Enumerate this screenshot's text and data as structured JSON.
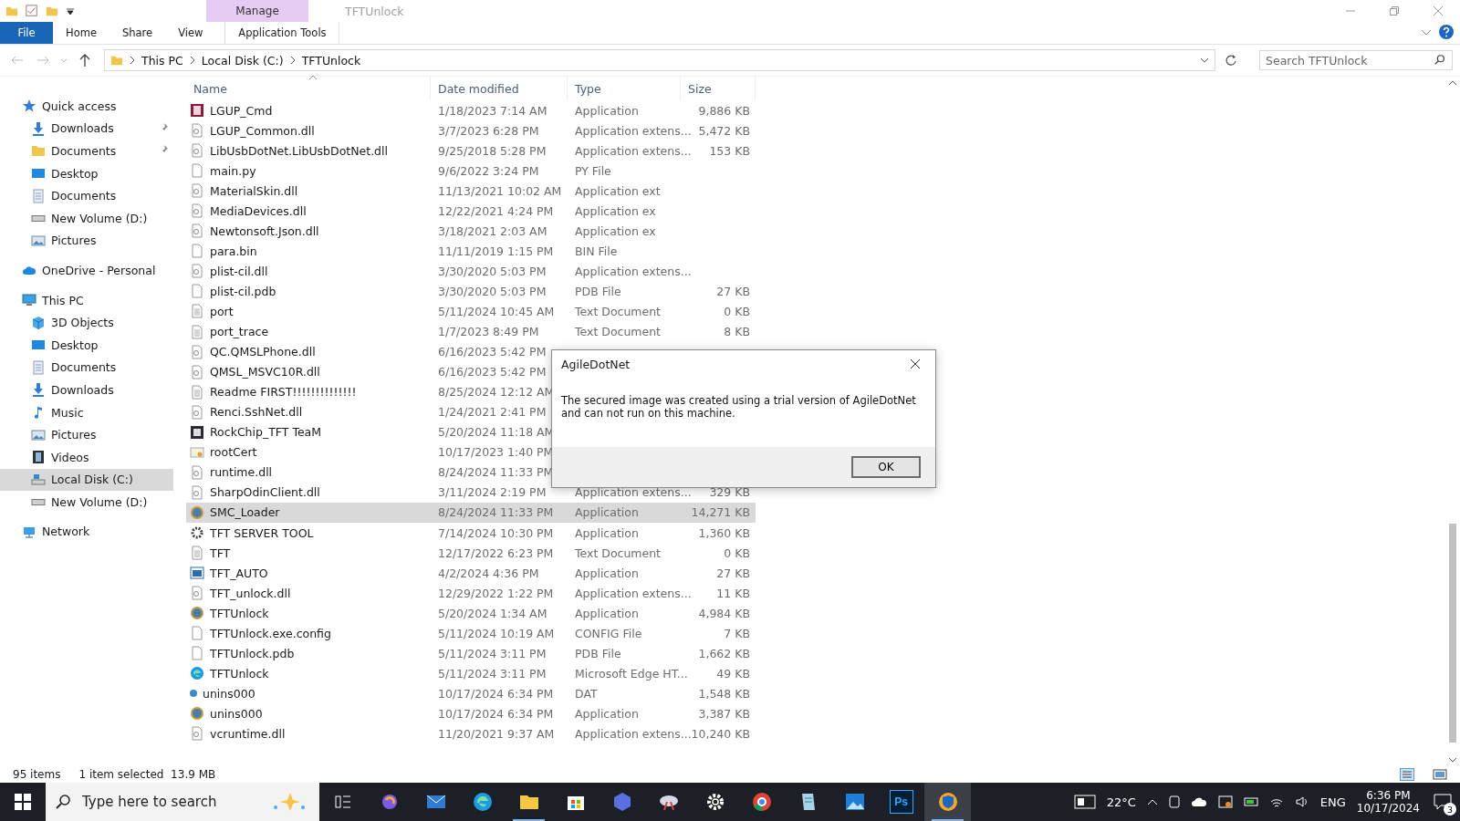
{
  "window": {
    "title": "TFTUnlock",
    "context_tab": "Manage"
  },
  "ribbon_tabs": [
    {
      "label": "File",
      "kind": "file"
    },
    {
      "label": "Home",
      "kind": "plain"
    },
    {
      "label": "Share",
      "kind": "plain"
    },
    {
      "label": "View",
      "kind": "plain"
    },
    {
      "label": "Application Tools",
      "kind": "contextual"
    }
  ],
  "address": {
    "path": [
      "This PC",
      "Local Disk (C:)",
      "TFTUnlock"
    ]
  },
  "search": {
    "placeholder": "Search TFTUnlock"
  },
  "sidebar": {
    "items": [
      {
        "label": "Quick access",
        "kind": "star",
        "selected": false,
        "children": [
          {
            "label": "Downloads",
            "kind": "download",
            "pinned": true,
            "selected": false
          },
          {
            "label": "Documents",
            "kind": "folder",
            "pinned": true,
            "selected": false
          },
          {
            "label": "Desktop",
            "kind": "desktop",
            "pinned": false,
            "selected": false
          },
          {
            "label": "Documents",
            "kind": "document",
            "pinned": false,
            "selected": false
          },
          {
            "label": "New Volume (D:)",
            "kind": "drive",
            "pinned": false,
            "selected": false
          },
          {
            "label": "Pictures",
            "kind": "pictures",
            "pinned": false,
            "selected": false
          }
        ]
      },
      {
        "label": "OneDrive - Personal",
        "kind": "cloud",
        "selected": false
      },
      {
        "label": "This PC",
        "kind": "pc",
        "selected": false,
        "children": [
          {
            "label": "3D Objects",
            "kind": "cube",
            "selected": false
          },
          {
            "label": "Desktop",
            "kind": "desktop",
            "selected": false
          },
          {
            "label": "Documents",
            "kind": "document",
            "selected": false
          },
          {
            "label": "Downloads",
            "kind": "download",
            "selected": false
          },
          {
            "label": "Music",
            "kind": "music",
            "selected": false
          },
          {
            "label": "Pictures",
            "kind": "pictures",
            "selected": false
          },
          {
            "label": "Videos",
            "kind": "video",
            "selected": false
          },
          {
            "label": "Local Disk (C:)",
            "kind": "windrive",
            "selected": true
          },
          {
            "label": "New Volume (D:)",
            "kind": "drive",
            "selected": false
          }
        ]
      },
      {
        "label": "Network",
        "kind": "network",
        "selected": false
      }
    ]
  },
  "table": {
    "columns": [
      {
        "label": "Name",
        "sorted": true
      },
      {
        "label": "Date modified",
        "sorted": false
      },
      {
        "label": "Type",
        "sorted": false
      },
      {
        "label": "Size",
        "sorted": false
      }
    ],
    "rows": [
      {
        "name": "LGUP_Cmd",
        "date": "1/18/2023 7:14 AM",
        "type": "Application",
        "size": "9,886 KB",
        "kind": "exe-red",
        "selected": false
      },
      {
        "name": "LGUP_Common.dll",
        "date": "3/7/2023 6:28 PM",
        "type": "Application extens...",
        "size": "5,472 KB",
        "kind": "dll",
        "selected": false
      },
      {
        "name": "LibUsbDotNet.LibUsbDotNet.dll",
        "date": "9/25/2018 5:28 PM",
        "type": "Application extens...",
        "size": "153 KB",
        "kind": "dll",
        "selected": false
      },
      {
        "name": "main.py",
        "date": "9/6/2022 3:24 PM",
        "type": "PY File",
        "kind": "blank",
        "selected": false
      },
      {
        "name": "MaterialSkin.dll",
        "date": "11/13/2021 10:02 AM",
        "type": "Application ext",
        "kind": "dll",
        "selected": false
      },
      {
        "name": "MediaDevices.dll",
        "date": "12/22/2021 4:24 PM",
        "type": "Application ex",
        "kind": "dll",
        "selected": false
      },
      {
        "name": "Newtonsoft.Json.dll",
        "date": "3/18/2021 2:03 AM",
        "type": "Application ex",
        "kind": "dll",
        "selected": false
      },
      {
        "name": "para.bin",
        "date": "11/11/2019 1:15 PM",
        "type": "BIN File",
        "kind": "blank",
        "selected": false
      },
      {
        "name": "plist-cil.dll",
        "date": "3/30/2020 5:03 PM",
        "type": "Application extens...",
        "kind": "dll",
        "selected": false
      },
      {
        "name": "plist-cil.pdb",
        "date": "3/30/2020 5:03 PM",
        "type": "PDB File",
        "size": "27 KB",
        "kind": "blank",
        "selected": false
      },
      {
        "name": "port",
        "date": "5/11/2024 10:45 AM",
        "type": "Text Document",
        "size": "0 KB",
        "kind": "text",
        "selected": false
      },
      {
        "name": "port_trace",
        "date": "1/7/2023 8:49 PM",
        "type": "Text Document",
        "size": "8 KB",
        "kind": "text",
        "selected": false
      },
      {
        "name": "QC.QMSLPhone.dll",
        "date": "6/16/2023 5:42 PM",
        "kind": "dll",
        "selected": false
      },
      {
        "name": "QMSL_MSVC10R.dll",
        "date": "6/16/2023 5:42 PM",
        "kind": "dll",
        "selected": false
      },
      {
        "name": "Readme FIRST!!!!!!!!!!!!!!",
        "date": "8/25/2024 12:12 AM",
        "kind": "text",
        "selected": false
      },
      {
        "name": "Renci.SshNet.dll",
        "date": "1/24/2021 2:41 PM",
        "kind": "dll",
        "selected": false
      },
      {
        "name": "RockChip_TFT TeaM",
        "date": "5/20/2024 11:18 AM",
        "kind": "exe-board",
        "selected": false
      },
      {
        "name": "rootCert",
        "date": "10/17/2023 1:40 PM",
        "kind": "cert",
        "selected": false
      },
      {
        "name": "runtime.dll",
        "date": "8/24/2024 11:33 PM",
        "kind": "dll",
        "selected": false
      },
      {
        "name": "SharpOdinClient.dll",
        "date": "3/11/2024 2:19 PM",
        "type": "Application extens...",
        "size": "329 KB",
        "kind": "dll",
        "selected": false
      },
      {
        "name": "SMC_Loader",
        "date": "8/24/2024 11:33 PM",
        "type": "Application",
        "size": "14,271 KB",
        "kind": "exe-globe",
        "selected": true
      },
      {
        "name": "TFT SERVER TOOL",
        "date": "7/14/2024 10:30 PM",
        "type": "Application",
        "size": "1,360 KB",
        "kind": "exe-gear",
        "selected": false
      },
      {
        "name": "TFT",
        "date": "12/17/2022 6:23 PM",
        "type": "Text Document",
        "size": "0 KB",
        "kind": "text",
        "selected": false
      },
      {
        "name": "TFT_AUTO",
        "date": "4/2/2024 4:36 PM",
        "type": "Application",
        "size": "27 KB",
        "kind": "exe-window",
        "selected": false
      },
      {
        "name": "TFT_unlock.dll",
        "date": "12/29/2022 1:22 PM",
        "type": "Application extens...",
        "size": "11 KB",
        "kind": "dll",
        "selected": false
      },
      {
        "name": "TFTUnlock",
        "date": "5/20/2024 1:34 AM",
        "type": "Application",
        "size": "4,984 KB",
        "kind": "exe-globe",
        "selected": false
      },
      {
        "name": "TFTUnlock.exe.config",
        "date": "5/11/2024 10:19 AM",
        "type": "CONFIG File",
        "size": "7 KB",
        "kind": "blank",
        "selected": false
      },
      {
        "name": "TFTUnlock.pdb",
        "date": "5/11/2024 3:11 PM",
        "type": "PDB File",
        "size": "1,662 KB",
        "kind": "blank",
        "selected": false
      },
      {
        "name": "TFTUnlock",
        "date": "5/11/2024 3:11 PM",
        "type": "Microsoft Edge HT...",
        "size": "49 KB",
        "kind": "edge",
        "selected": false
      },
      {
        "name": "unins000",
        "date": "10/17/2024 6:34 PM",
        "type": "DAT",
        "size": "1,548 KB",
        "kind": "dat",
        "selected": false
      },
      {
        "name": "unins000",
        "date": "10/17/2024 6:34 PM",
        "type": "Application",
        "size": "3,387 KB",
        "kind": "exe-globe",
        "selected": false
      },
      {
        "name": "vcruntime.dll",
        "date": "11/20/2021 9:37 AM",
        "type": "Application extens...",
        "size": "10,240 KB",
        "kind": "dll",
        "selected": false
      }
    ]
  },
  "status_bar": {
    "count": "95 items",
    "selection": "1 item selected  13.9 MB"
  },
  "dialog": {
    "title": "AgileDotNet",
    "message": "The secured image was created using a trial version of AgileDotNet and can not run on this machine.",
    "buttons": [
      "OK"
    ]
  },
  "taskbar": {
    "search_placeholder": "Type here to search",
    "apps": [
      {
        "kind": "swirl",
        "active": false
      },
      {
        "kind": "mail",
        "active": false
      },
      {
        "kind": "browser",
        "active": false
      },
      {
        "kind": "folder",
        "active": true
      },
      {
        "kind": "store",
        "active": false
      },
      {
        "kind": "hexagon",
        "active": false
      },
      {
        "kind": "brush",
        "active": false
      },
      {
        "kind": "gear",
        "active": false
      },
      {
        "kind": "chrome",
        "active": false
      },
      {
        "kind": "notepad",
        "active": false
      },
      {
        "kind": "photos",
        "active": false
      },
      {
        "kind": "ps",
        "label": "Ps",
        "active": false
      },
      {
        "kind": "shield",
        "active": true
      }
    ],
    "temperature": "22°C",
    "language": "ENG",
    "time": "6:36 PM",
    "date": "10/17/2024",
    "notifications": "3"
  }
}
